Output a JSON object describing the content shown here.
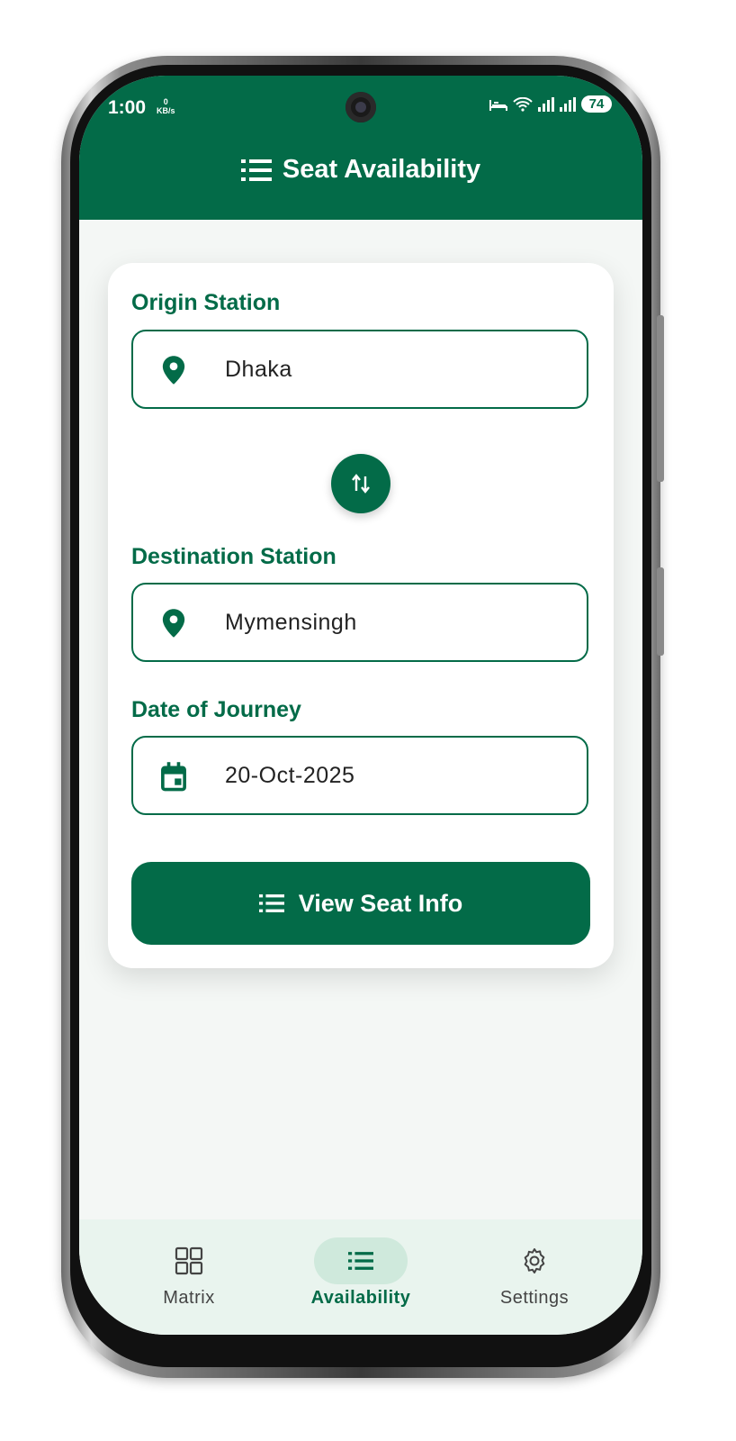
{
  "status_bar": {
    "time": "1:00",
    "data_rate_value": "0",
    "data_rate_unit": "KB/s",
    "battery": "74"
  },
  "header": {
    "title": "Seat Availability",
    "icon": "list-icon"
  },
  "form": {
    "origin": {
      "label": "Origin Station",
      "value": "Dhaka",
      "icon": "location-pin-icon"
    },
    "swap_icon": "swap-vertical-icon",
    "destination": {
      "label": "Destination Station",
      "value": "Mymensingh",
      "icon": "location-pin-icon"
    },
    "date": {
      "label": "Date of Journey",
      "value": "20-Oct-2025",
      "icon": "calendar-icon"
    },
    "submit_label": "View Seat Info"
  },
  "bottom_nav": {
    "items": [
      {
        "label": "Matrix",
        "icon": "grid-icon",
        "active": false
      },
      {
        "label": "Availability",
        "icon": "list-icon",
        "active": true
      },
      {
        "label": "Settings",
        "icon": "gear-icon",
        "active": false
      }
    ]
  },
  "colors": {
    "primary": "#036b48",
    "active_pill": "#cfe9dc",
    "nav_background": "#e9f4ee",
    "screen_background": "#f4f7f5"
  }
}
